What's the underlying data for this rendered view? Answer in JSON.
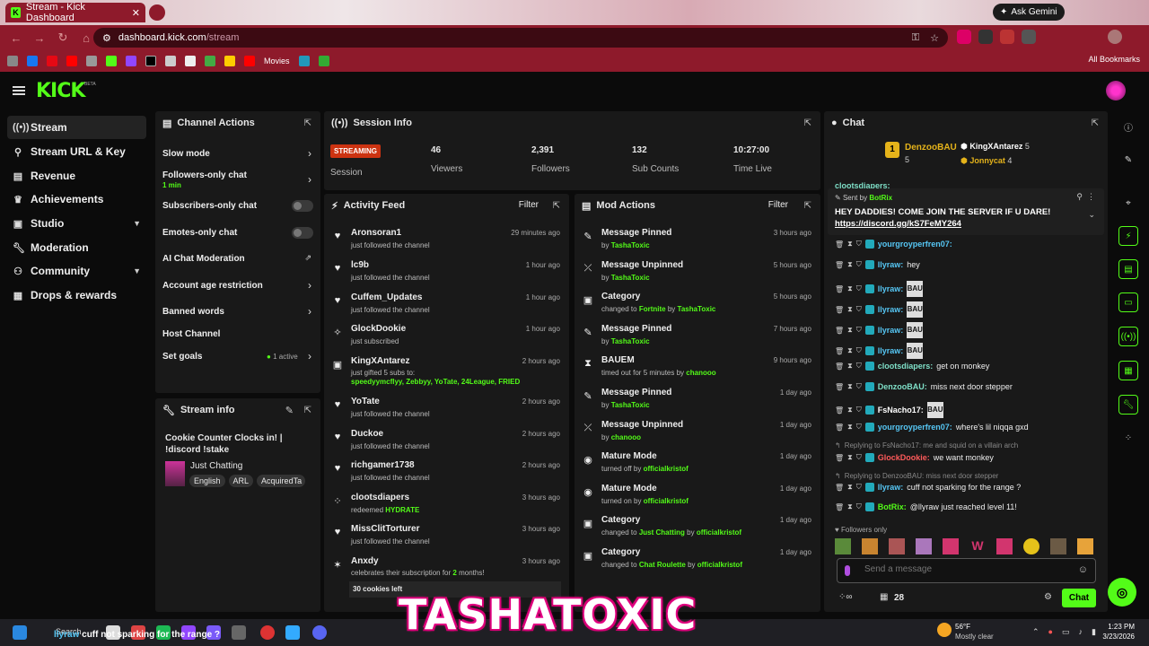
{
  "browser": {
    "tab_title": "Stream - Kick Dashboard",
    "gemini_label": "Ask Gemini",
    "url_host": "dashboard.kick.com",
    "url_path": "/stream",
    "bookmark_movies": "Movies",
    "all_bookmarks": "All Bookmarks"
  },
  "brand": {
    "logo": "KICK",
    "beta": "BETA",
    "accent": "#53fc18"
  },
  "sidebar": {
    "items": [
      {
        "label": "Stream",
        "icon": "broadcast-icon"
      },
      {
        "label": "Stream URL & Key",
        "icon": "link-icon"
      },
      {
        "label": "Revenue",
        "icon": "revenue-icon"
      },
      {
        "label": "Achievements",
        "icon": "trophy-icon"
      },
      {
        "label": "Studio",
        "icon": "studio-icon"
      },
      {
        "label": "Moderation",
        "icon": "wrench-icon"
      },
      {
        "label": "Community",
        "icon": "community-icon"
      },
      {
        "label": "Drops & rewards",
        "icon": "gift-icon"
      }
    ]
  },
  "channel_actions": {
    "title": "Channel Actions",
    "slow_mode": "Slow mode",
    "followers_only": "Followers-only chat",
    "followers_only_value": "1 min",
    "subscribers_only": "Subscribers-only chat",
    "emotes_only": "Emotes-only chat",
    "ai_chat": "AI Chat Moderation",
    "account_age": "Account age restriction",
    "banned_words": "Banned words",
    "host_channel": "Host Channel",
    "set_goals": "Set goals",
    "goals_active": "1 active"
  },
  "stream_info": {
    "title": "Stream info",
    "stream_title": "Cookie Counter Clocks in! | !discord !stake",
    "category": "Just Chatting",
    "tags": [
      "English",
      "ARL",
      "AcquiredTa"
    ]
  },
  "session": {
    "title": "Session Info",
    "status": "STREAMING",
    "session_label": "Session",
    "stats": [
      {
        "value": "46",
        "label": "Viewers"
      },
      {
        "value": "2,391",
        "label": "Followers"
      },
      {
        "value": "132",
        "label": "Sub Counts"
      },
      {
        "value": "10:27:00",
        "label": "Time Live"
      }
    ]
  },
  "activity": {
    "title": "Activity Feed",
    "filter": "Filter",
    "items": [
      {
        "name": "Aronsoran1",
        "sub": "just followed the channel",
        "time": "29 minutes ago"
      },
      {
        "name": "lc9b",
        "sub": "just followed the channel",
        "time": "1 hour ago"
      },
      {
        "name": "Cuffem_Updates",
        "sub": "just followed the channel",
        "time": "1 hour ago"
      },
      {
        "name": "GlockDookie",
        "sub": "just subscribed",
        "time": "1 hour ago"
      },
      {
        "name": "KingXAntarez",
        "sub": "just gifted 5 subs to:",
        "time": "2 hours ago"
      },
      {
        "name": "YoTate",
        "sub": "just followed the channel",
        "time": "2 hours ago"
      },
      {
        "name": "Duckoe",
        "sub": "just followed the channel",
        "time": "2 hours ago"
      },
      {
        "name": "richgamer1738",
        "sub": "just followed the channel",
        "time": "2 hours ago"
      },
      {
        "name": "clootsdiapers",
        "sub": "redeemed",
        "time": "3 hours ago"
      },
      {
        "name": "MissClitTorturer",
        "sub": "just followed the channel",
        "time": "3 hours ago"
      },
      {
        "name": "Anxdy",
        "sub": "celebrates their subscription for",
        "time": "3 hours ago"
      }
    ],
    "gift_recipients": "speedyymcflyy, Zebbyy, YoTate, 24League, FRIED",
    "redeem_item": "HYDRATE",
    "sub_months": "2",
    "sub_months_suffix": "months!",
    "cookies_left": "30 cookies left"
  },
  "mod_actions": {
    "title": "Mod Actions",
    "filter": "Filter",
    "items": [
      {
        "action": "Message Pinned",
        "pre": "by",
        "target": "",
        "mid": "",
        "by": "TashaToxic",
        "time": "3 hours ago"
      },
      {
        "action": "Message Unpinned",
        "pre": "by",
        "target": "",
        "mid": "",
        "by": "TashaToxic",
        "time": "5 hours ago"
      },
      {
        "action": "Category",
        "pre": "changed to",
        "target": "Fortnite",
        "mid": "by",
        "by": "TashaToxic",
        "time": "5 hours ago"
      },
      {
        "action": "Message Pinned",
        "pre": "by",
        "target": "",
        "mid": "",
        "by": "TashaToxic",
        "time": "7 hours ago"
      },
      {
        "action": "BAUEM",
        "pre": "timed out for 5 minutes by",
        "target": "",
        "mid": "",
        "by": "chanooo",
        "time": "9 hours ago"
      },
      {
        "action": "Message Pinned",
        "pre": "by",
        "target": "",
        "mid": "",
        "by": "TashaToxic",
        "time": "1 day ago"
      },
      {
        "action": "Message Unpinned",
        "pre": "by",
        "target": "",
        "mid": "",
        "by": "chanooo",
        "time": "1 day ago"
      },
      {
        "action": "Mature Mode",
        "pre": "turned off by",
        "target": "",
        "mid": "",
        "by": "officialkristof",
        "time": "1 day ago"
      },
      {
        "action": "Mature Mode",
        "pre": "turned on by",
        "target": "",
        "mid": "",
        "by": "officialkristof",
        "time": "1 day ago"
      },
      {
        "action": "Category",
        "pre": "changed to",
        "target": "Just Chatting",
        "mid": "by",
        "by": "officialkristof",
        "time": "1 day ago"
      },
      {
        "action": "Category",
        "pre": "changed to",
        "target": "Chat Roulette",
        "mid": "by",
        "by": "officialkristof",
        "time": "1 day ago"
      }
    ]
  },
  "chat": {
    "title": "Chat",
    "leaders": [
      {
        "rank": "1",
        "name": "DenzooBAU",
        "count": "5"
      },
      {
        "name": "KingXAntarez",
        "count": "5"
      },
      {
        "name": "Jonnycat",
        "count": "4"
      }
    ],
    "scroll_user": "clootsdiapers:",
    "pinned": {
      "sent_by": "Sent by",
      "user": "BotRix",
      "text": "HEY DADDIES! COME JOIN THE SERVER IF U DARE!",
      "link": "https://discord.gg/kS7FeMY264"
    },
    "messages": [
      {
        "user": "yourgroyperfren07:",
        "text": "",
        "color": "#56c7f5",
        "emote": false
      },
      {
        "user": "llyraw:",
        "text": "hey",
        "color": "#56c7f5",
        "emote": false
      },
      {
        "user": "llyraw:",
        "text": "",
        "color": "#56c7f5",
        "emote": true
      },
      {
        "user": "llyraw:",
        "text": "",
        "color": "#56c7f5",
        "emote": true
      },
      {
        "user": "llyraw:",
        "text": "",
        "color": "#56c7f5",
        "emote": true
      },
      {
        "user": "llyraw:",
        "text": "",
        "color": "#56c7f5",
        "emote": true
      },
      {
        "user": "clootsdiapers:",
        "text": "get on monkey",
        "color": "#7fe0c8",
        "emote": false
      },
      {
        "user": "DenzooBAU:",
        "text": "miss next door stepper",
        "color": "#7fe0c8",
        "emote": false
      },
      {
        "user": "FsNacho17:",
        "text": "",
        "color": "#ffffff",
        "emote": true
      },
      {
        "user": "yourgroyperfren07:",
        "text": "where's lil niqqa gxd",
        "color": "#56c7f5",
        "emote": false
      },
      {
        "reply": "Replying to FsNacho17: me and squid on a villain arch"
      },
      {
        "user": "GlockDookie:",
        "text": "we want monkey",
        "color": "#ff5a5a",
        "emote": false
      },
      {
        "reply": "Replying to DenzooBAU: miss next door stepper"
      },
      {
        "user": "llyraw:",
        "text": "cuff not sparking for the range ?",
        "color": "#56c7f5",
        "emote": false
      },
      {
        "user": "BotRix:",
        "text": "@llyraw just reached level 11!",
        "color": "#53fc18",
        "emote": false
      }
    ],
    "bau_emote": "BAU",
    "followers_only": "Followers only",
    "placeholder": "Send a message",
    "points": "28",
    "send_label": "Chat"
  },
  "overlay": {
    "name": "TASHATOXIC",
    "ticker_user": "llyraw",
    "ticker_text": "cuff not sparking for the range ?"
  },
  "taskbar": {
    "search": "Search",
    "weather_temp": "56°F",
    "weather_desc": "Mostly clear",
    "time": "1:23 PM",
    "date": "3/23/2026"
  }
}
